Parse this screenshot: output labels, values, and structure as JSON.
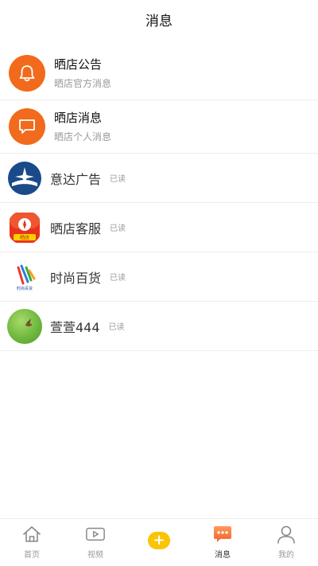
{
  "header": {
    "title": "消息"
  },
  "system_items": [
    {
      "title": "晒店公告",
      "subtitle": "晒店官方消息",
      "icon": "bell-icon"
    },
    {
      "title": "晒店消息",
      "subtitle": "晒店个人消息",
      "icon": "chat-bubble-icon"
    }
  ],
  "chats": [
    {
      "name": "意达广告",
      "status": "已读"
    },
    {
      "name": "晒店客服",
      "status": "已读",
      "avatar_text": "晒店"
    },
    {
      "name": "时尚百货",
      "status": "已读",
      "avatar_text": "时尚百货"
    },
    {
      "name": "萱萱444",
      "status": "已读"
    }
  ],
  "tabbar": {
    "home": "首页",
    "video": "视频",
    "plus": "+",
    "messages": "消息",
    "mine": "我的"
  },
  "colors": {
    "accent_orange": "#f26a1b",
    "plus_yellow": "#f9c400",
    "divider": "#ececec"
  }
}
